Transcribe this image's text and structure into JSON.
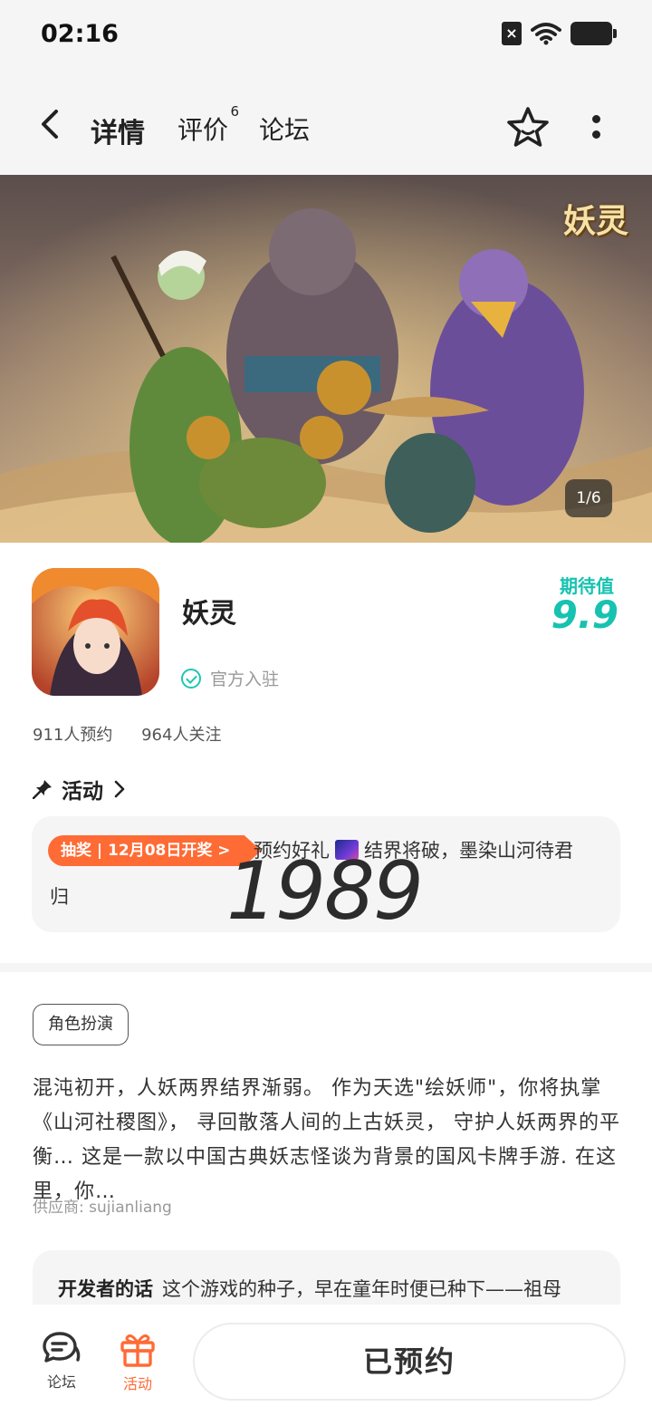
{
  "status_bar": {
    "time": "02:16"
  },
  "nav": {
    "tabs": [
      {
        "label": "详情"
      },
      {
        "label": "评价",
        "badge": "6"
      },
      {
        "label": "论坛"
      }
    ]
  },
  "banner": {
    "logo_text": "妖灵",
    "counter": "1/6"
  },
  "app": {
    "name": "妖灵",
    "official_label": "官方入驻",
    "expect_label": "期待值",
    "expect_score": "9.9",
    "reservations": "911人预约",
    "followers": "964人关注"
  },
  "activity": {
    "heading": "活动",
    "badge": "抽奖 | 12月08日开奖 >",
    "text_line1_a": "预约好礼",
    "text_line1_b": "结界将破，墨染山河待君",
    "text_line2": "归",
    "overlay_number": "1989"
  },
  "details": {
    "genre_tag": "角色扮演",
    "description": "混沌初开，人妖两界结界渐弱。 作为天选\"绘妖师\"，你将执掌《山河社稷图》， 寻回散落人间的上古妖灵， 守护人妖两界的平衡… 这是一款以中国古典妖志怪谈为背景的国风卡牌手游. 在这里，你…",
    "supplier": "供应商: sujianliang",
    "dev_title": "开发者的话",
    "dev_text": "这个游戏的种子，早在童年时便已种下——祖母"
  },
  "bottom_bar": {
    "forum_label": "论坛",
    "activity_label": "活动",
    "reserve_button": "已预约"
  },
  "colors": {
    "accent": "#1fd4c0",
    "score": "#17c2b0",
    "orange": "#ff6b35"
  }
}
